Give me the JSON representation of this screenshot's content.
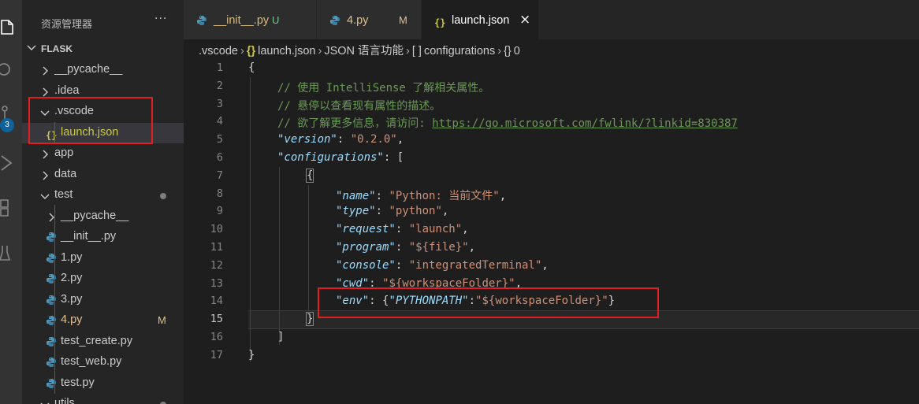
{
  "colors": {
    "accent": "#0e639c",
    "highlight": "#e02020",
    "modified": "#e2c08d",
    "json_icon": "#cbcb41",
    "python_icon": "#519aba"
  },
  "activity_bar": {
    "icons": [
      "files-icon",
      "search-icon",
      "source-control-icon",
      "run-debug-icon",
      "extensions-icon",
      "testing-icon"
    ],
    "source_control_badge": "3"
  },
  "sidebar": {
    "title": "资源管理器",
    "more": "···",
    "section": "FLASK",
    "items": [
      {
        "name": "__pycache__",
        "type": "folder",
        "expanded": false,
        "level": 1
      },
      {
        "name": ".idea",
        "type": "folder",
        "expanded": false,
        "level": 1
      },
      {
        "name": ".vscode",
        "type": "folder",
        "expanded": true,
        "level": 1
      },
      {
        "name": "launch.json",
        "type": "json",
        "level": 2,
        "selected": true
      },
      {
        "name": "app",
        "type": "folder",
        "expanded": false,
        "level": 1
      },
      {
        "name": "data",
        "type": "folder",
        "expanded": false,
        "level": 1
      },
      {
        "name": "test",
        "type": "folder",
        "expanded": true,
        "level": 1,
        "dot": true
      },
      {
        "name": "__pycache__",
        "type": "folder",
        "expanded": false,
        "level": 2
      },
      {
        "name": "__init__.py",
        "type": "python",
        "level": 2
      },
      {
        "name": "1.py",
        "type": "python",
        "level": 2
      },
      {
        "name": "2.py",
        "type": "python",
        "level": 2
      },
      {
        "name": "3.py",
        "type": "python",
        "level": 2
      },
      {
        "name": "4.py",
        "type": "python",
        "level": 2,
        "status": "M"
      },
      {
        "name": "test_create.py",
        "type": "python",
        "level": 2
      },
      {
        "name": "test_web.py",
        "type": "python",
        "level": 2
      },
      {
        "name": "test.py",
        "type": "python",
        "level": 2
      },
      {
        "name": "utils",
        "type": "folder",
        "expanded": true,
        "level": 1,
        "dot": true
      }
    ]
  },
  "tabs": [
    {
      "name": "__init__.py",
      "status": "U",
      "type": "python",
      "active": false
    },
    {
      "name": "4.py",
      "status": "M",
      "type": "python",
      "active": false
    },
    {
      "name": "launch.json",
      "status": "",
      "type": "json",
      "active": true,
      "close": "×"
    }
  ],
  "breadcrumb": {
    "folder": ".vscode",
    "file_icon": "{}",
    "file": "launch.json",
    "schema": "JSON 语言功能",
    "array_icon": "[ ]",
    "array": "configurations",
    "obj_icon": "{}",
    "obj": "0"
  },
  "editor": {
    "current_line": 15,
    "lines": [
      {
        "n": "1",
        "indent": 0,
        "tokens": [
          {
            "t": "{",
            "c": "brk"
          }
        ]
      },
      {
        "n": "2",
        "indent": 1,
        "tokens": [
          {
            "t": "// 使用 IntelliSense 了解相关属性。",
            "c": "cm"
          }
        ]
      },
      {
        "n": "3",
        "indent": 1,
        "tokens": [
          {
            "t": "// 悬停以查看现有属性的描述。",
            "c": "cm"
          }
        ]
      },
      {
        "n": "4",
        "indent": 1,
        "tokens": [
          {
            "t": "// 欲了解更多信息，请访问: ",
            "c": "cm"
          },
          {
            "t": "https://go.microsoft.com/fwlink/?linkid=830387",
            "c": "url"
          }
        ]
      },
      {
        "n": "5",
        "indent": 1,
        "tokens": [
          {
            "t": "\"version\"",
            "c": "key"
          },
          {
            "t": ": ",
            "c": "brk"
          },
          {
            "t": "\"0.2.0\"",
            "c": "str"
          },
          {
            "t": ",",
            "c": "brk"
          }
        ]
      },
      {
        "n": "6",
        "indent": 1,
        "tokens": [
          {
            "t": "\"configurations\"",
            "c": "key"
          },
          {
            "t": ": [",
            "c": "brk"
          }
        ]
      },
      {
        "n": "7",
        "indent": 2,
        "tokens": [
          {
            "t": "{",
            "c": "brk brk-box"
          }
        ]
      },
      {
        "n": "8",
        "indent": 3,
        "tokens": [
          {
            "t": "\"name\"",
            "c": "key"
          },
          {
            "t": ": ",
            "c": "brk"
          },
          {
            "t": "\"Python: 当前文件\"",
            "c": "str"
          },
          {
            "t": ",",
            "c": "brk"
          }
        ]
      },
      {
        "n": "9",
        "indent": 3,
        "tokens": [
          {
            "t": "\"type\"",
            "c": "key"
          },
          {
            "t": ": ",
            "c": "brk"
          },
          {
            "t": "\"python\"",
            "c": "str"
          },
          {
            "t": ",",
            "c": "brk"
          }
        ]
      },
      {
        "n": "10",
        "indent": 3,
        "tokens": [
          {
            "t": "\"request\"",
            "c": "key"
          },
          {
            "t": ": ",
            "c": "brk"
          },
          {
            "t": "\"launch\"",
            "c": "str"
          },
          {
            "t": ",",
            "c": "brk"
          }
        ]
      },
      {
        "n": "11",
        "indent": 3,
        "tokens": [
          {
            "t": "\"program\"",
            "c": "key"
          },
          {
            "t": ": ",
            "c": "brk"
          },
          {
            "t": "\"${file}\"",
            "c": "str"
          },
          {
            "t": ",",
            "c": "brk"
          }
        ]
      },
      {
        "n": "12",
        "indent": 3,
        "tokens": [
          {
            "t": "\"console\"",
            "c": "key"
          },
          {
            "t": ": ",
            "c": "brk"
          },
          {
            "t": "\"integratedTerminal\"",
            "c": "str"
          },
          {
            "t": ",",
            "c": "brk"
          }
        ]
      },
      {
        "n": "13",
        "indent": 3,
        "tokens": [
          {
            "t": "\"cwd\"",
            "c": "key"
          },
          {
            "t": ": ",
            "c": "brk"
          },
          {
            "t": "\"${workspaceFolder}\"",
            "c": "str"
          },
          {
            "t": ",",
            "c": "brk"
          }
        ]
      },
      {
        "n": "14",
        "indent": 3,
        "tokens": [
          {
            "t": "\"env\"",
            "c": "key"
          },
          {
            "t": ": {",
            "c": "brk"
          },
          {
            "t": "\"PYTHONPATH\"",
            "c": "key"
          },
          {
            "t": ":",
            "c": "brk"
          },
          {
            "t": "\"${workspaceFolder}\"",
            "c": "str"
          },
          {
            "t": "}",
            "c": "brk"
          }
        ]
      },
      {
        "n": "15",
        "indent": 2,
        "tokens": [
          {
            "t": "}",
            "c": "brk brk-box"
          }
        ]
      },
      {
        "n": "16",
        "indent": 1,
        "tokens": [
          {
            "t": "]",
            "c": "brk"
          }
        ]
      },
      {
        "n": "17",
        "indent": 0,
        "tokens": [
          {
            "t": "}",
            "c": "brk"
          }
        ]
      }
    ]
  }
}
